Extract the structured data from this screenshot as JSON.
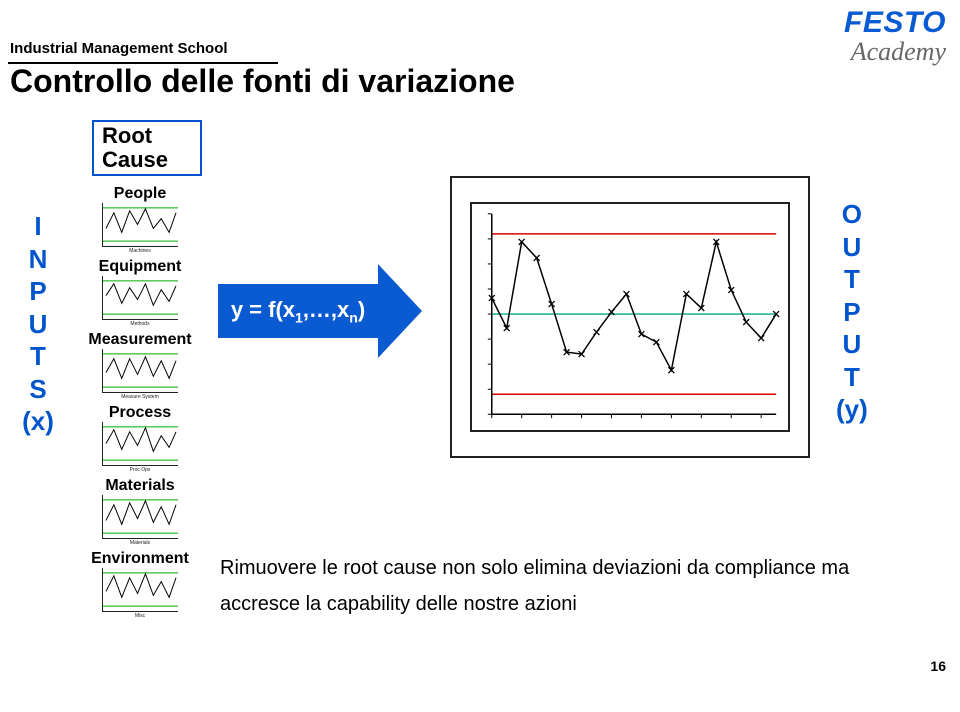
{
  "header": {
    "school": "Industrial Management School",
    "title": "Controllo delle fonti di variazione",
    "logo_top": "FESTO",
    "logo_bottom": "Academy"
  },
  "root_cause": {
    "line1": "Root",
    "line2": "Cause"
  },
  "inputs": {
    "letters": [
      "I",
      "N",
      "P",
      "U",
      "T",
      "S",
      "(x)"
    ]
  },
  "categories": [
    {
      "label": "People",
      "caption": "Machines"
    },
    {
      "label": "Equipment",
      "caption": "Methods"
    },
    {
      "label": "Measurement",
      "caption": "Measure System"
    },
    {
      "label": "Process",
      "caption": "Proc Ops"
    },
    {
      "label": "Materials",
      "caption": "Materials"
    },
    {
      "label": "Environment",
      "caption": "Misc"
    }
  ],
  "formula": {
    "text_prefix": "y = f(x",
    "sub1": "1",
    "mid": ",…,x",
    "sub2": "n",
    "suffix": ")"
  },
  "output": {
    "letters": [
      "O",
      "U",
      "T",
      "P",
      "U",
      "T",
      "(y)"
    ]
  },
  "paragraph": {
    "line1": "Rimuovere le root cause non solo elimina deviazioni da compliance ma",
    "line2": "accresce la capability delle nostre azioni"
  },
  "page_number": "16",
  "chart_data": {
    "type": "line",
    "title": "",
    "xlabel": "",
    "ylabel": "",
    "ylim": [
      0,
      10
    ],
    "x": [
      1,
      2,
      3,
      4,
      5,
      6,
      7,
      8,
      9,
      10,
      11,
      12,
      13,
      14,
      15,
      16,
      17,
      18,
      19,
      20
    ],
    "values": [
      5.8,
      4.3,
      8.6,
      7.8,
      5.5,
      3.1,
      3.0,
      4.1,
      5.1,
      6.0,
      4.0,
      3.6,
      2.2,
      6.0,
      5.3,
      8.6,
      6.2,
      4.6,
      3.8,
      5.0
    ],
    "limits": {
      "upper": 9.0,
      "center": 5.0,
      "lower": 1.0
    }
  },
  "mini_chart_template": {
    "type": "line",
    "x": [
      0,
      1,
      2,
      3,
      4,
      5,
      6,
      7,
      8,
      9
    ],
    "values": [
      4,
      7,
      3,
      8,
      5,
      9,
      4,
      6,
      3,
      7
    ],
    "ylim": [
      0,
      10
    ],
    "limits": {
      "upper": 9,
      "lower": 1
    }
  }
}
